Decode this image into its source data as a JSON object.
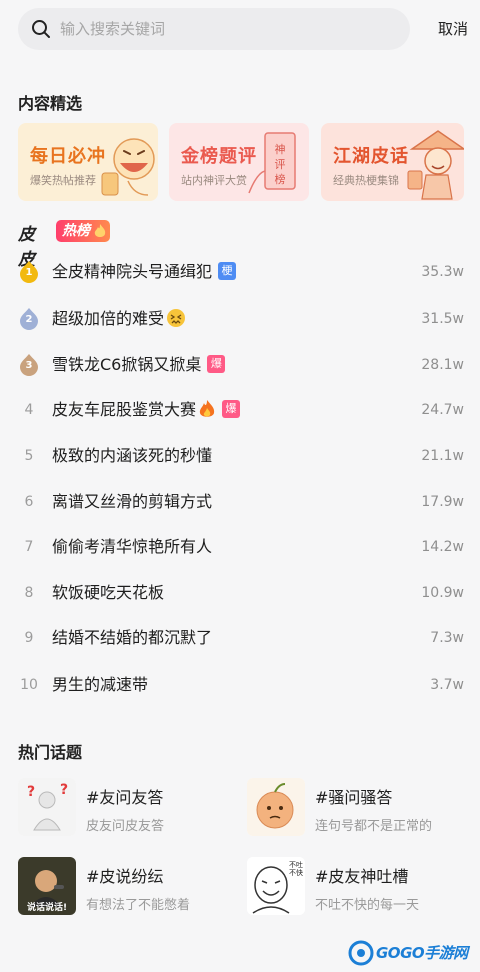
{
  "search": {
    "placeholder": "输入搜索关键词",
    "cancel_label": "取消"
  },
  "featured_section": {
    "title": "内容精选",
    "cards": [
      {
        "title": "每日必冲",
        "subtitle": "爆笑热帖推荐",
        "title_color": "#e8741f",
        "bg_color": "#fcefd6"
      },
      {
        "title": "金榜题评",
        "subtitle": "站内神评大赏",
        "title_color": "#ea5a4f",
        "bg_color": "#fde6e6"
      },
      {
        "title": "江湖皮话",
        "subtitle": "经典热梗集锦",
        "title_color": "#e3552f",
        "bg_color": "#fde3dc"
      }
    ]
  },
  "hot_list": {
    "brand": "皮皮",
    "tag": "热榜",
    "items": [
      {
        "rank": "1",
        "title": "全皮精神院头号通缉犯",
        "badge": "梗",
        "badge_type": "blue",
        "value": "35.3w"
      },
      {
        "rank": "2",
        "title": "超级加倍的难受",
        "emoji": "persevering-face-icon",
        "value": "31.5w"
      },
      {
        "rank": "3",
        "title": "雪铁龙C6掀锅又掀桌",
        "badge": "爆",
        "badge_type": "pink",
        "value": "28.1w"
      },
      {
        "rank": "4",
        "title": "皮友车屁股鉴赏大赛",
        "emoji": "fire-icon",
        "badge": "爆",
        "badge_type": "pink",
        "value": "24.7w"
      },
      {
        "rank": "5",
        "title": "极致的内涵该死的秒懂",
        "value": "21.1w"
      },
      {
        "rank": "6",
        "title": "离谱又丝滑的剪辑方式",
        "value": "17.9w"
      },
      {
        "rank": "7",
        "title": "偷偷考清华惊艳所有人",
        "value": "14.2w"
      },
      {
        "rank": "8",
        "title": "软饭硬吃天花板",
        "value": "10.9w"
      },
      {
        "rank": "9",
        "title": "结婚不结婚的都沉默了",
        "value": "7.3w"
      },
      {
        "rank": "10",
        "title": "男生的减速带",
        "value": "3.7w"
      }
    ]
  },
  "topics_section": {
    "title": "热门话题",
    "topics": [
      {
        "title": "#友问友答",
        "desc": "皮友问皮友答"
      },
      {
        "title": "#骚问骚答",
        "desc": "连句号都不是正常的"
      },
      {
        "title": "#皮说纷纭",
        "desc": "有想法了不能憋着",
        "thumb_caption": "说话说话!"
      },
      {
        "title": "#皮友神吐槽",
        "desc": "不吐不快的每一天",
        "thumb_caption": "不吐不快"
      }
    ]
  },
  "watermark": {
    "text": "GOGO手游网"
  },
  "colors": {
    "gold": "#f2b90f",
    "silver": "#9fb0d6",
    "bronze": "#c9a27e",
    "accent_pink": "#ff5a86",
    "accent_blue": "#4e8cf3"
  }
}
